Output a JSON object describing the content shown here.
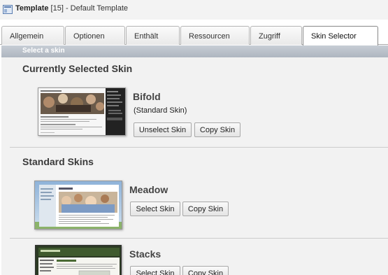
{
  "window": {
    "title_bold": "Template",
    "title_rest": " [15] - Default Template"
  },
  "tabs": [
    {
      "label": "Allgemein",
      "active": false
    },
    {
      "label": "Optionen",
      "active": false
    },
    {
      "label": "Enthält",
      "active": false
    },
    {
      "label": "Ressourcen",
      "active": false
    },
    {
      "label": "Zugriff",
      "active": false
    },
    {
      "label": "Skin Selector",
      "active": true
    }
  ],
  "section": {
    "header": "Select a skin"
  },
  "current": {
    "heading": "Currently Selected Skin",
    "skin": {
      "name": "Bifold",
      "note": "(Standard Skin)",
      "unselect_label": "Unselect Skin",
      "copy_label": "Copy Skin"
    }
  },
  "standard": {
    "heading": "Standard Skins",
    "skins": [
      {
        "name": "Meadow",
        "select_label": "Select Skin",
        "copy_label": "Copy Skin"
      },
      {
        "name": "Stacks",
        "select_label": "Select Skin",
        "copy_label": "Copy Skin"
      }
    ]
  },
  "colors": {
    "section_bar": "#b6bdc6",
    "content_bg": "#f2f2f2",
    "heading": "#3a3a3a"
  }
}
